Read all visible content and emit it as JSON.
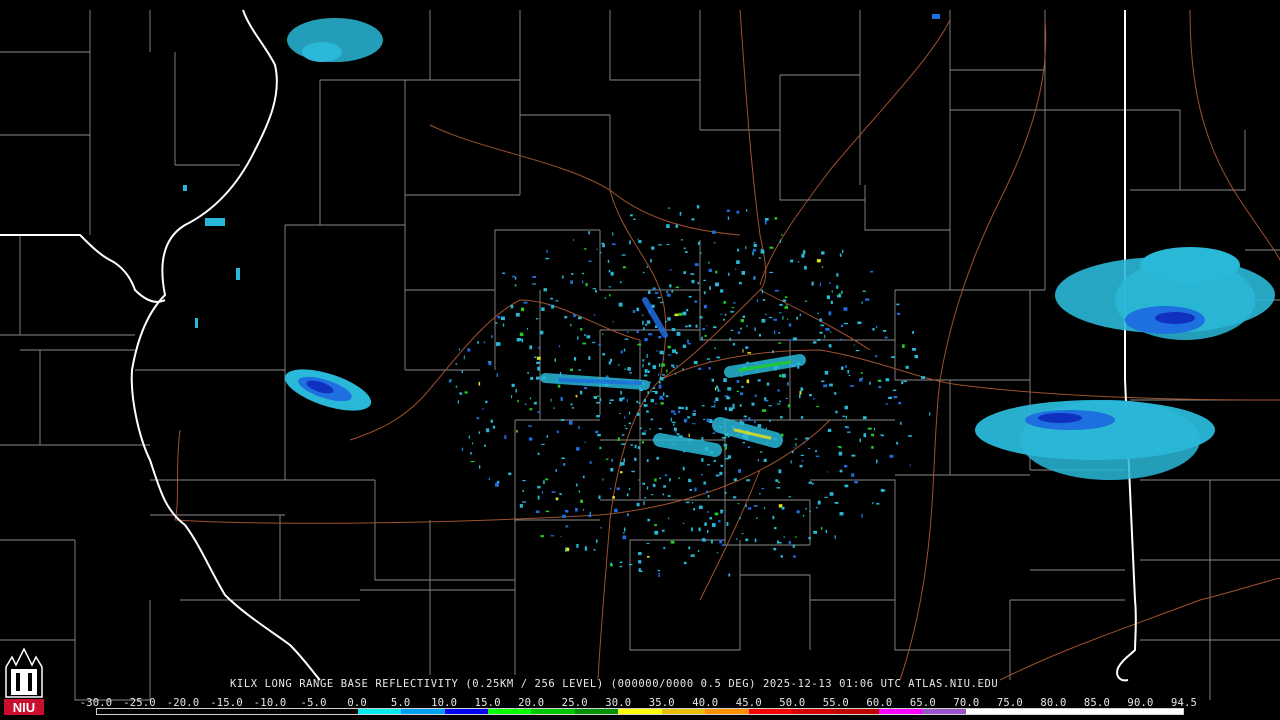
{
  "product_caption": "KILX LONG RANGE BASE REFLECTIVITY (0.25KM / 256 LEVEL) (000000/0000 0.5 DEG) 2025-12-13 01:06 UTC  ATLAS.NIU.EDU",
  "logo_text": "NIU",
  "legend": {
    "ticks": [
      "-30.0",
      "-25.0",
      "-20.0",
      "-15.0",
      "-10.0",
      "-5.0",
      "0.0",
      "5.0",
      "10.0",
      "15.0",
      "20.0",
      "25.0",
      "30.0",
      "35.0",
      "40.0",
      "45.0",
      "50.0",
      "55.0",
      "60.0",
      "65.0",
      "70.0",
      "75.0",
      "80.0",
      "85.0",
      "90.0",
      "94.5"
    ],
    "colors": [
      "#000000",
      "#000000",
      "#000000",
      "#000000",
      "#000000",
      "#000000",
      "#00ecec",
      "#01a0f6",
      "#0000f6",
      "#00ff00",
      "#00c800",
      "#009000",
      "#ffff00",
      "#e7c000",
      "#ff9000",
      "#ff0000",
      "#d60000",
      "#c00000",
      "#ff00ff",
      "#9955c9",
      "#ffffff",
      "#ffffff",
      "#ffffff",
      "#ffffff",
      "#ffffff"
    ]
  },
  "map_colors": {
    "background": "#000000",
    "county_lines": "#8a8a8a",
    "state_lines": "#ffffff",
    "highways": "#a0522d",
    "echo_light": "#2ab8d8",
    "echo_mid": "#1e6fe0",
    "echo_strong": "#1030c0",
    "echo_green": "#20d020",
    "echo_yellow": "#e0e020"
  }
}
